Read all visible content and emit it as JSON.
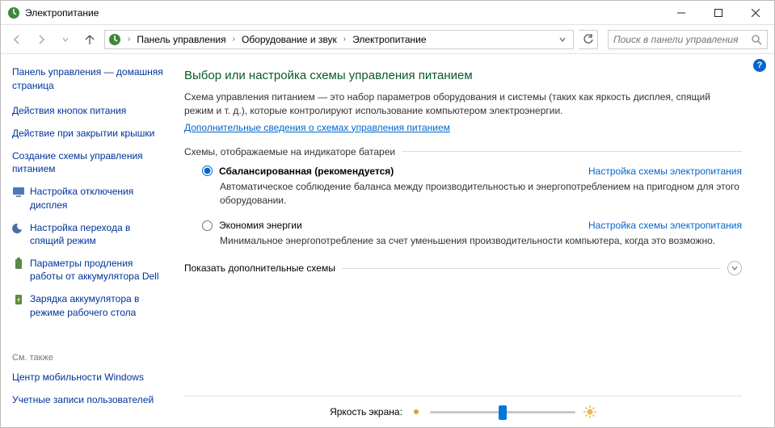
{
  "window": {
    "title": "Электропитание"
  },
  "breadcrumb": {
    "root": "Панель управления",
    "mid": "Оборудование и звук",
    "leaf": "Электропитание"
  },
  "search": {
    "placeholder": "Поиск в панели управления"
  },
  "sidebar": {
    "home": "Панель управления — домашняя страница",
    "links": [
      {
        "label": "Действия кнопок питания",
        "icon": false
      },
      {
        "label": "Действие при закрытии крышки",
        "icon": false
      },
      {
        "label": "Создание схемы управления питанием",
        "icon": false
      },
      {
        "label": "Настройка отключения дисплея",
        "icon": true,
        "iconName": "display-icon"
      },
      {
        "label": "Настройка перехода в спящий режим",
        "icon": true,
        "iconName": "sleep-icon"
      },
      {
        "label": "Параметры продления работы от аккумулятора Dell",
        "icon": true,
        "iconName": "battery-icon"
      },
      {
        "label": "Зарядка аккумулятора в режиме рабочего стола",
        "icon": true,
        "iconName": "charge-icon"
      }
    ],
    "see_also_label": "См. также",
    "see_also": [
      "Центр мобильности Windows",
      "Учетные записи пользователей"
    ]
  },
  "main": {
    "heading": "Выбор или настройка схемы управления питанием",
    "description": "Схема управления питанием — это набор параметров оборудования и системы (таких как яркость дисплея, спящий режим и т. д.), которые контролируют использование компьютером электроэнергии.",
    "learn_more": "Дополнительные сведения о схемах управления питанием",
    "group_label": "Схемы, отображаемые на индикаторе батареи",
    "plans": [
      {
        "name": "Сбалансированная (рекомендуется)",
        "selected": true,
        "config_label": "Настройка схемы электропитания",
        "desc": "Автоматическое соблюдение баланса между производительностью и энергопотреблением на пригодном для этого оборудовании."
      },
      {
        "name": "Экономия энергии",
        "selected": false,
        "config_label": "Настройка схемы электропитания",
        "desc": "Минимальное энергопотребление за счет уменьшения производительности компьютера, когда это возможно."
      }
    ],
    "expand_label": "Показать дополнительные схемы",
    "brightness_label": "Яркость экрана:"
  }
}
